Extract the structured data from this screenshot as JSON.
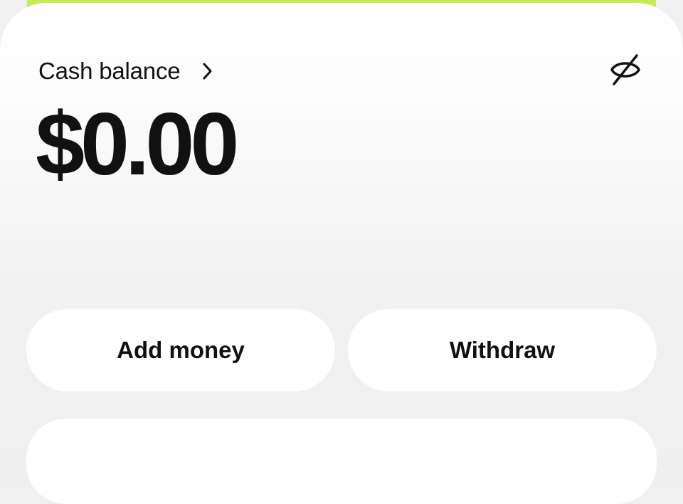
{
  "balance": {
    "label": "Cash balance",
    "amount": "$0.00"
  },
  "icons": {
    "chevron": "chevron-right-icon",
    "hide_balance": "eye-off-icon"
  },
  "actions": {
    "add_money_label": "Add money",
    "withdraw_label": "Withdraw"
  },
  "colors": {
    "accent": "#c8ea57",
    "card": "#ffffff",
    "background": "#f0f0f0",
    "text": "#111111"
  }
}
